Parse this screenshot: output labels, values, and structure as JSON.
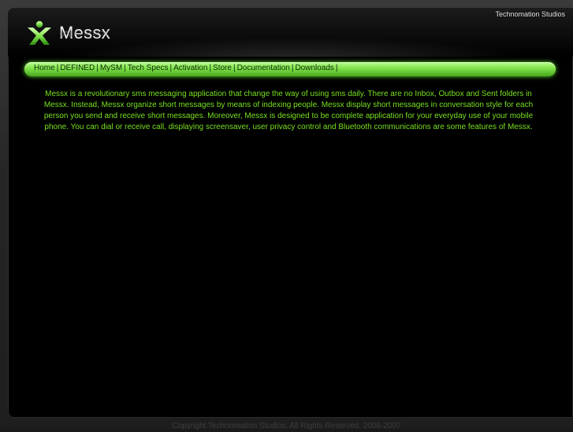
{
  "header": {
    "studio_name": "Technomation Studios",
    "logo_text": "Messx",
    "logo_icon": "messx-x-icon",
    "accent_color": "#7fe14a"
  },
  "nav": {
    "items": [
      {
        "label": "Home"
      },
      {
        "label": "DEFINED"
      },
      {
        "label": "MySM"
      },
      {
        "label": "Tech Specs"
      },
      {
        "label": "Activation"
      },
      {
        "label": "Store"
      },
      {
        "label": "Documentation"
      },
      {
        "label": "Downloads"
      }
    ],
    "separator": "|"
  },
  "main": {
    "description": "Messx is a revolutionary sms messaging application that change the way of using sms daily. There are no Inbox, Outbox and Sent folders in Messx. Instead, Messx organize short messages by means of indexing people. Messx display short messages in conversation style for each person you send and receive short messages. Moreover, Messx is designed to be complete application for your everyday use of your mobile phone. You can dial or receive call, displaying screensaver, user privacy control and Bluetooth communications are some features of Messx."
  },
  "footer": {
    "copyright": "Copyright Technomation Studios. All Rights Reserved. 2006-2007"
  }
}
